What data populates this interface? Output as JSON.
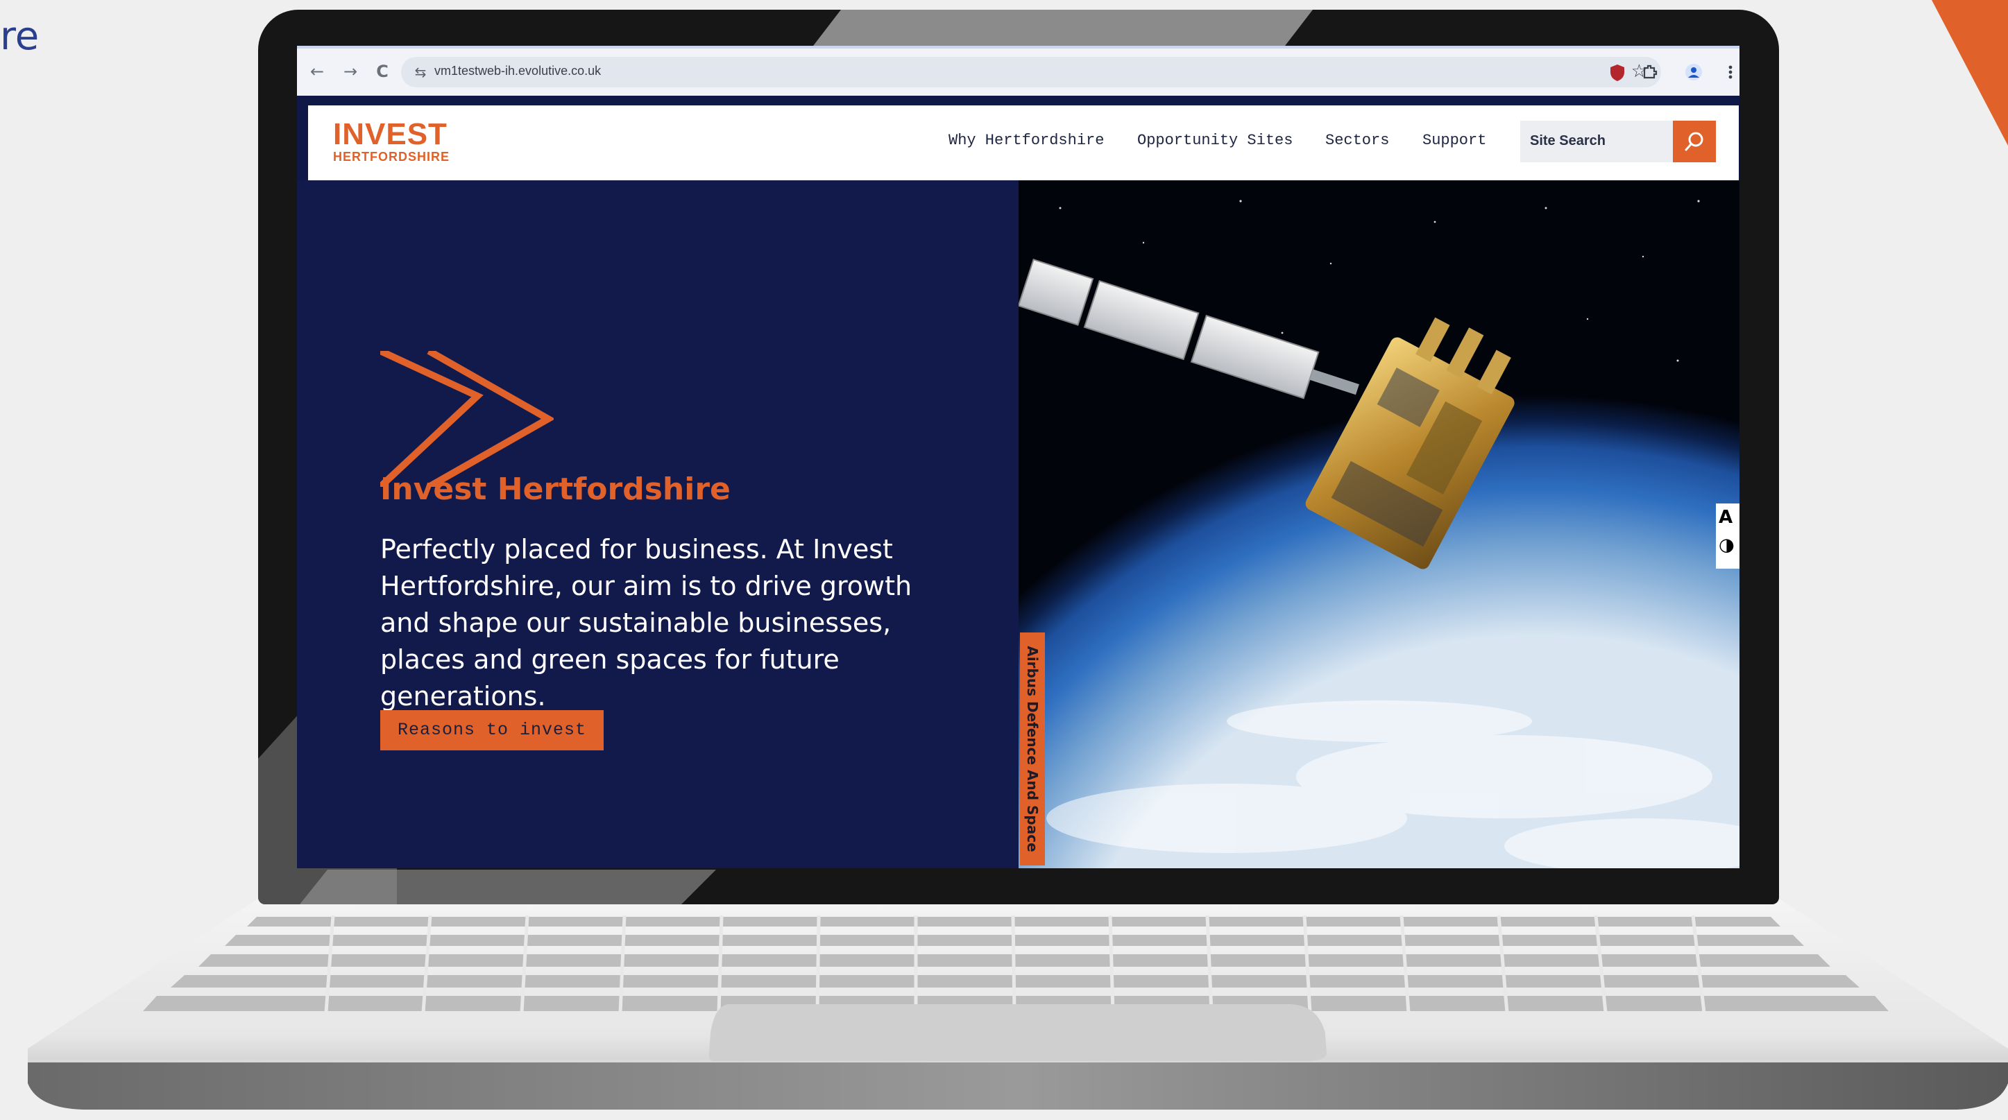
{
  "slide": {
    "partial_title": "re"
  },
  "browser": {
    "url": "vm1testweb-ih.evolutive.co.uk",
    "back_icon": "←",
    "forward_icon": "→",
    "reload_icon": "C",
    "tune_icon": "⇆",
    "bookmark_icon": "☆",
    "extensions": [
      "shield-extension-icon",
      "puzzle-extension-icon",
      "profile-icon",
      "menu-icon"
    ]
  },
  "site": {
    "logo": {
      "top": "INVEST",
      "bottom": "HERTFORDSHIRE"
    },
    "nav": [
      {
        "label": "Why Hertfordshire"
      },
      {
        "label": "Opportunity Sites"
      },
      {
        "label": "Sectors"
      },
      {
        "label": "Support"
      }
    ],
    "search": {
      "label": "Site Search"
    },
    "hero": {
      "title": "Invest Hertfordshire",
      "body": "Perfectly placed for business. At Invest Hertfordshire, our aim is to drive growth and shape our sustainable businesses, places and green spaces for future generations.",
      "cta": "Reasons to invest",
      "image_credit": "Airbus Defence And Space"
    },
    "accessibility": {
      "text_size": "A",
      "contrast": "◑"
    }
  },
  "colors": {
    "brand_orange": "#e0612a",
    "navy": "#121a4c",
    "slide_blue": "#2b3f8f"
  }
}
